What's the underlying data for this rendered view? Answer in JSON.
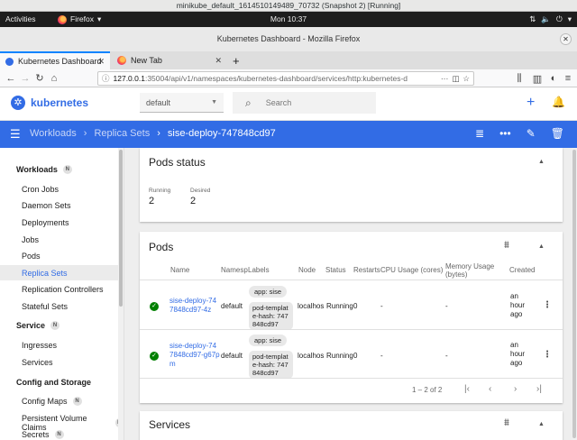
{
  "vm": {
    "title": "minikube_default_1614510149489_70732 (Snapshot 2) [Running]"
  },
  "gnome": {
    "activities": "Activities",
    "app": "Firefox",
    "clock": "Mon 10:37"
  },
  "firefox": {
    "window_title": "Kubernetes Dashboard - Mozilla Firefox",
    "tabs": [
      {
        "label": "Kubernetes Dashboard"
      },
      {
        "label": "New Tab"
      }
    ],
    "url_host": "127.0.0.1",
    "url_path": ":35004/api/v1/namespaces/kubernetes-dashboard/services/http:kubernetes-d",
    "url_more": "···"
  },
  "header": {
    "logo_text": "kubernetes",
    "namespace": "default",
    "search_placeholder": "Search"
  },
  "breadcrumb": {
    "items": [
      "Workloads",
      "Replica Sets",
      "sise-deploy-747848cd97"
    ]
  },
  "sidebar": {
    "sections": [
      {
        "label": "Workloads",
        "badge": "N"
      },
      {
        "label": "Service",
        "badge": "N"
      },
      {
        "label": "Config and Storage"
      }
    ],
    "workloads": [
      "Cron Jobs",
      "Daemon Sets",
      "Deployments",
      "Jobs",
      "Pods",
      "Replica Sets",
      "Replication Controllers",
      "Stateful Sets"
    ],
    "service": [
      "Ingresses",
      "Services"
    ],
    "config": [
      {
        "label": "Config Maps",
        "badge": "N"
      },
      {
        "label": "Persistent Volume Claims",
        "badge": "N"
      },
      {
        "label": "Secrets",
        "badge": "N"
      }
    ]
  },
  "pods_status": {
    "title": "Pods status",
    "running_label": "Running",
    "running_value": "2",
    "desired_label": "Desired",
    "desired_value": "2"
  },
  "pods": {
    "title": "Pods",
    "columns": [
      "Name",
      "Namespace",
      "Labels",
      "Node",
      "Status",
      "Restarts",
      "CPU Usage (cores)",
      "Memory Usage (bytes)",
      "Created"
    ],
    "col_namespace_short": "Namesp",
    "col_restarts_short": "Restarts",
    "rows": [
      {
        "name": "sise-deploy-747848cd97-4z",
        "namespace": "default",
        "label1": "app: sise",
        "label2": "pod-template-hash: 747848cd97",
        "node": "localhos",
        "status": "Running",
        "restarts": "0",
        "cpu": "-",
        "memory": "-",
        "created": "an hour ago"
      },
      {
        "name": "sise-deploy-747848cd97-g67pm",
        "namespace": "default",
        "label1": "app: sise",
        "label2": "pod-template-hash: 747848cd97",
        "node": "localhos",
        "status": "Running",
        "restarts": "0",
        "cpu": "-",
        "memory": "-",
        "created": "an hour ago"
      }
    ],
    "pagination": "1 – 2 of 2"
  },
  "services": {
    "title": "Services"
  },
  "colors": {
    "accent": "#326ce5",
    "ok": "#008000"
  }
}
